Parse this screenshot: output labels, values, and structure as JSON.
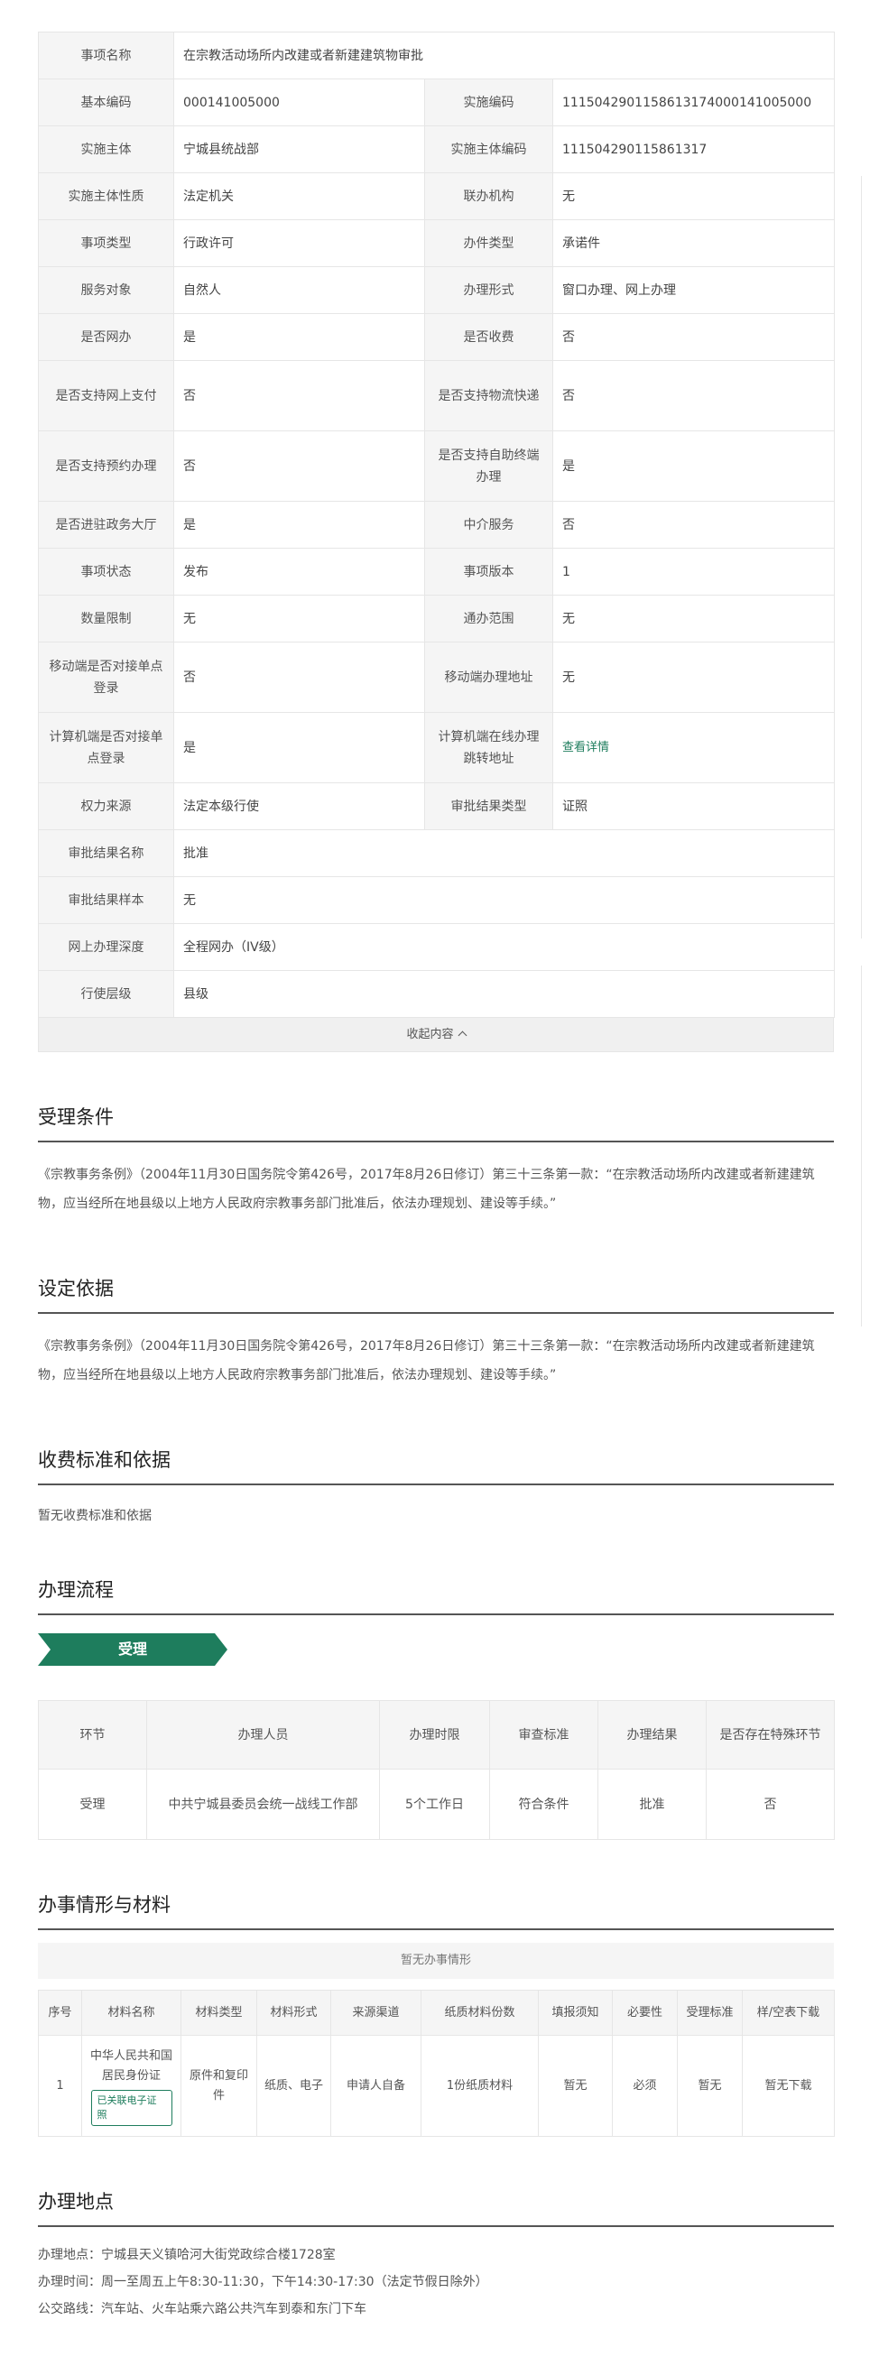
{
  "info_rows": [
    {
      "l1": "事项名称",
      "v1": "在宗教活动场所内改建或者新建建筑物审批",
      "full": true,
      "h": 52
    },
    {
      "l1": "基本编码",
      "v1": "000141005000",
      "l2": "实施编码",
      "v2": "11150429011586131740001410050​00",
      "h": 52
    },
    {
      "l1": "实施主体",
      "v1": "宁城县统战部",
      "l2": "实施主体编码",
      "v2": "111504290115861317",
      "h": 52
    },
    {
      "l1": "实施主体性质",
      "v1": "法定机关",
      "l2": "联办机构",
      "v2": "无",
      "h": 52
    },
    {
      "l1": "事项类型",
      "v1": "行政许可",
      "l2": "办件类型",
      "v2": "承诺件",
      "h": 52
    },
    {
      "l1": "服务对象",
      "v1": "自然人",
      "l2": "办理形式",
      "v2": "窗口办理、网上办理",
      "h": 52
    },
    {
      "l1": "是否网办",
      "v1": "是",
      "l2": "是否收费",
      "v2": "否",
      "h": 52
    },
    {
      "l1": "是否支持网上支付",
      "v1": "否",
      "l2": "是否支持物流快递",
      "v2": "否",
      "h": 78
    },
    {
      "l1": "是否支持预约办理",
      "v1": "否",
      "l2": "是否支持自助终端办理",
      "v2": "是",
      "h": 78
    },
    {
      "l1": "是否进驻政务大厅",
      "v1": "是",
      "l2": "中介服务",
      "v2": "否",
      "h": 52
    },
    {
      "l1": "事项状态",
      "v1": "发布",
      "l2": "事项版本",
      "v2": "1",
      "h": 52
    },
    {
      "l1": "数量限制",
      "v1": "无",
      "l2": "通办范围",
      "v2": "无",
      "h": 52
    },
    {
      "l1": "移动端是否对接单点登录",
      "v1": "否",
      "l2": "移动端办理地址",
      "v2": "无",
      "h": 78
    },
    {
      "l1": "计算机端是否对接单点登录",
      "v1": "是",
      "l2": "计算机端在线办理跳转地址",
      "v2": "查看详情",
      "v2link": true,
      "h": 78
    },
    {
      "l1": "权力来源",
      "v1": "法定本级行使",
      "l2": "审批结果类型",
      "v2": "证照",
      "h": 52
    },
    {
      "l1": "审批结果名称",
      "v1": "批准",
      "full": true,
      "h": 52
    },
    {
      "l1": "审批结果样本",
      "v1": "无",
      "full": true,
      "h": 52
    },
    {
      "l1": "网上办理深度",
      "v1": "全程网办（IV级）",
      "full": true,
      "h": 52
    },
    {
      "l1": "行使层级",
      "v1": "县级",
      "full": true,
      "h": 52
    }
  ],
  "collapse_label": "收起内容",
  "sections": {
    "accept": {
      "title": "受理条件",
      "text": "《宗教事务条例》（2004年11月30日国务院令第426号，2017年8月26日修订）第三十三条第一款：“在宗教活动场所内改建或者新建建筑物，应当经所在地县级以上地方人民政府宗教事务部门批准后，依法办理规划、建设等手续。”"
    },
    "basis": {
      "title": "设定依据",
      "text": "《宗教事务条例》（2004年11月30日国务院令第426号，2017年8月26日修订）第三十三条第一款：“在宗教活动场所内改建或者新建建筑物，应当经所在地县级以上地方人民政府宗教事务部门批准后，依法办理规划、建设等手续。”"
    },
    "fee": {
      "title": "收费标准和依据",
      "text": "暂无收费标准和依据"
    },
    "process": {
      "title": "办理流程",
      "step": "受理"
    },
    "materials": {
      "title": "办事情形与材料",
      "no_situation": "暂无办事情形"
    },
    "location": {
      "title": "办理地点",
      "lines": [
        "办理地点：宁城县天义镇哈河大街党政综合楼1728室",
        "办理时间：周一至周五上午8:30-11:30，下午14:30-17:30（法定节假日除外）",
        "公交路线：汽车站、火车站乘六路公共汽车到泰和东门下车"
      ]
    }
  },
  "flow_table": {
    "headers": [
      "环节",
      "办理人员",
      "办理时限",
      "审查标准",
      "办理结果",
      "是否存在特殊环节"
    ],
    "rows": [
      [
        "受理",
        "中共宁城县委员会统一战线工作部",
        "5个工作日",
        "符合条件",
        "批准",
        "否"
      ]
    ]
  },
  "materials_table": {
    "headers": [
      "序号",
      "材料名称",
      "材料类型",
      "材料形式",
      "来源渠道",
      "纸质材料份数",
      "填报须知",
      "必要性",
      "受理标准",
      "样/空表下载"
    ],
    "rows": [
      {
        "no": "1",
        "name": "中华人民共和国居民身份证",
        "badge": "已关联电子证照",
        "type": "原件和复印件",
        "form": "纸质、电子",
        "source": "申请人自备",
        "copies": "1份纸质材料",
        "notice": "暂无",
        "required": "必须",
        "standard": "暂无",
        "download": "暂无下载"
      }
    ]
  }
}
